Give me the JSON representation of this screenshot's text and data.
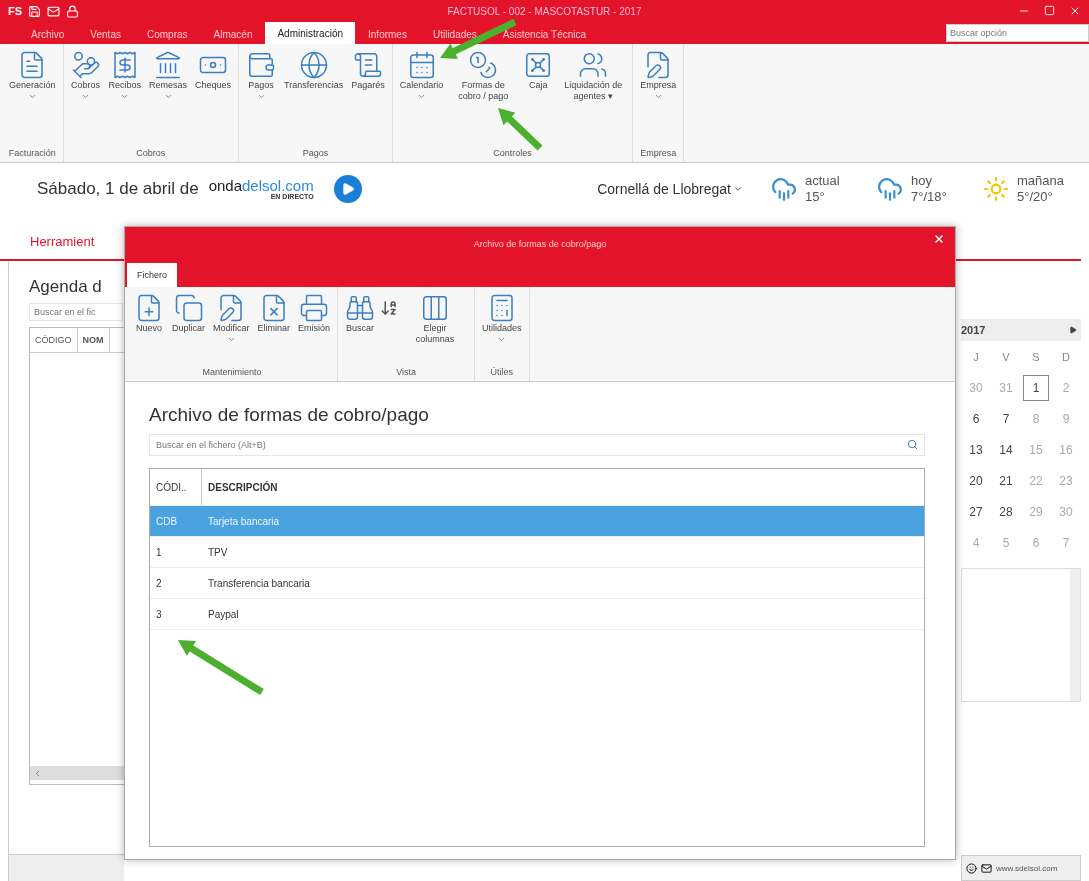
{
  "window": {
    "app_logo": "FS",
    "title": "FACTUSOL - 002 - MASCOTASTUR - 2017"
  },
  "menu_tabs": [
    {
      "label": "Archivo",
      "selected": false
    },
    {
      "label": "Ventas",
      "selected": false
    },
    {
      "label": "Compras",
      "selected": false
    },
    {
      "label": "Almacén",
      "selected": false
    },
    {
      "label": "Administración",
      "selected": true
    },
    {
      "label": "Informes",
      "selected": false
    },
    {
      "label": "Utilidades",
      "selected": false
    },
    {
      "label": "Asistencia Técnica",
      "selected": false
    }
  ],
  "option_search": {
    "placeholder": "Buscar opción"
  },
  "ribbon": [
    {
      "group": "Facturación",
      "buttons": [
        {
          "label": "Generación",
          "dropdown": true
        }
      ]
    },
    {
      "group": "Cobros",
      "buttons": [
        {
          "label": "Cobros",
          "dropdown": true
        },
        {
          "label": "Recibos",
          "dropdown": true
        },
        {
          "label": "Remesas",
          "dropdown": true
        },
        {
          "label": "Cheques",
          "dropdown": false
        }
      ]
    },
    {
      "group": "Pagos",
      "buttons": [
        {
          "label": "Pagos",
          "dropdown": true
        },
        {
          "label": "Transferencias",
          "dropdown": false
        },
        {
          "label": "Pagarés",
          "dropdown": false
        }
      ]
    },
    {
      "group": "Controles",
      "buttons": [
        {
          "label": "Calendario",
          "dropdown": true
        },
        {
          "label": "Formas de cobro / pago",
          "dropdown": false
        },
        {
          "label": "Caja",
          "dropdown": false
        },
        {
          "label": "Liquidación de agentes ▾",
          "dropdown": false
        }
      ]
    },
    {
      "group": "Empresa",
      "buttons": [
        {
          "label": "Empresa",
          "dropdown": true
        }
      ]
    }
  ],
  "header": {
    "date": "Sábado, 1 de abril de",
    "radio_logo": {
      "parts": [
        "onda",
        "delsol.com"
      ],
      "tagline": "EN DIRECTO"
    },
    "location": "Cornellá de Llobregat",
    "weather": [
      {
        "label": "actual",
        "temp": "15°",
        "kind": "rain"
      },
      {
        "label": "hoy",
        "temp": "7°/18°",
        "kind": "rain"
      },
      {
        "label": "mañana",
        "temp": "5°/20°",
        "kind": "sun"
      }
    ]
  },
  "tools_tab": "Herramient",
  "agenda": {
    "title": "Agenda d",
    "search_placeholder": "Buscar en el fic",
    "columns": [
      "CÓDIGO",
      "NOM"
    ]
  },
  "calendar": {
    "header": "2017",
    "weekdays": [
      "J",
      "V",
      "S",
      "D"
    ],
    "weeks": [
      [
        {
          "day": "30",
          "muted": true,
          "selected": false
        },
        {
          "day": "31",
          "muted": true,
          "selected": false
        },
        {
          "day": "1",
          "muted": false,
          "selected": true
        },
        {
          "day": "2",
          "muted": true,
          "selected": false
        }
      ],
      [
        {
          "day": "6",
          "muted": false,
          "selected": false
        },
        {
          "day": "7",
          "muted": false,
          "selected": false
        },
        {
          "day": "8",
          "muted": true,
          "selected": false
        },
        {
          "day": "9",
          "muted": true,
          "selected": false
        }
      ],
      [
        {
          "day": "13",
          "muted": false,
          "selected": false
        },
        {
          "day": "14",
          "muted": false,
          "selected": false
        },
        {
          "day": "15",
          "muted": true,
          "selected": false
        },
        {
          "day": "16",
          "muted": true,
          "selected": false
        }
      ],
      [
        {
          "day": "20",
          "muted": false,
          "selected": false
        },
        {
          "day": "21",
          "muted": false,
          "selected": false
        },
        {
          "day": "22",
          "muted": true,
          "selected": false
        },
        {
          "day": "23",
          "muted": true,
          "selected": false
        }
      ],
      [
        {
          "day": "27",
          "muted": false,
          "selected": false
        },
        {
          "day": "28",
          "muted": false,
          "selected": false
        },
        {
          "day": "29",
          "muted": true,
          "selected": false
        },
        {
          "day": "30",
          "muted": true,
          "selected": false
        }
      ],
      [
        {
          "day": "4",
          "muted": true,
          "selected": false
        },
        {
          "day": "5",
          "muted": true,
          "selected": false
        },
        {
          "day": "6",
          "muted": true,
          "selected": false
        },
        {
          "day": "7",
          "muted": true,
          "selected": false
        }
      ]
    ]
  },
  "status_bar": {
    "url": "www.sdelsol.com"
  },
  "dialog": {
    "title": "Archivo de formas de cobro/pago",
    "tabs": [
      {
        "label": "Fichero",
        "selected": true
      }
    ],
    "ribbon": [
      {
        "group": "Mantenimiento",
        "buttons": [
          {
            "label": "Nuevo",
            "dropdown": false
          },
          {
            "label": "Duplicar",
            "dropdown": false
          },
          {
            "label": "Modificar",
            "dropdown": true
          },
          {
            "label": "Eliminar",
            "dropdown": false
          },
          {
            "label": "Emisión",
            "dropdown": false
          }
        ]
      },
      {
        "group": "Vista",
        "buttons": [
          {
            "label": "Buscar",
            "dropdown": false
          },
          {
            "label": "Elegir columnas",
            "dropdown": false
          }
        ]
      },
      {
        "group": "Útiles",
        "buttons": [
          {
            "label": "Utilidades",
            "dropdown": true
          }
        ]
      }
    ],
    "heading": "Archivo de formas de cobro/pago",
    "search_placeholder": "Buscar en el fichero (Alt+B)",
    "columns": [
      "CÓDI..",
      "DESCRIPCIÓN"
    ],
    "rows": [
      {
        "code": "CDB",
        "description": "Tarjeta bancaria",
        "selected": true
      },
      {
        "code": "1",
        "description": "TPV",
        "selected": false
      },
      {
        "code": "2",
        "description": "Transferencia bancaria",
        "selected": false
      },
      {
        "code": "3",
        "description": "Paypal",
        "selected": false
      }
    ]
  }
}
